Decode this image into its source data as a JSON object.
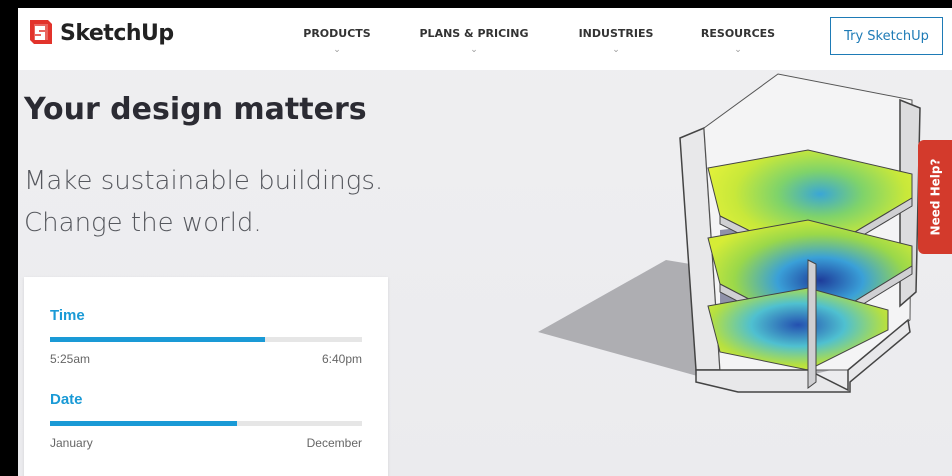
{
  "nav": {
    "logo_text": "SketchUp",
    "items": [
      {
        "label": "PRODUCTS"
      },
      {
        "label": "PLANS & PRICING"
      },
      {
        "label": "INDUSTRIES"
      },
      {
        "label": "RESOURCES"
      }
    ],
    "cta_label": "Try SketchUp"
  },
  "hero": {
    "title": "Your design matters",
    "subtitle_line1": "Make sustainable buildings.",
    "subtitle_line2": "Change the world."
  },
  "sliders": [
    {
      "label": "Time",
      "min_label": "5:25am",
      "max_label": "6:40pm",
      "fraction": 0.69
    },
    {
      "label": "Date",
      "min_label": "January",
      "max_label": "December",
      "fraction": 0.6
    }
  ],
  "help_tab": {
    "label": "Need Help?"
  },
  "colors": {
    "accent": "#1a9ad6",
    "cta": "#1e7bb6",
    "help": "#d33a2c",
    "brand": "#e2332b"
  },
  "icons": {
    "logo": "sketchup-logo-icon",
    "chevron": "chevron-down-icon"
  }
}
